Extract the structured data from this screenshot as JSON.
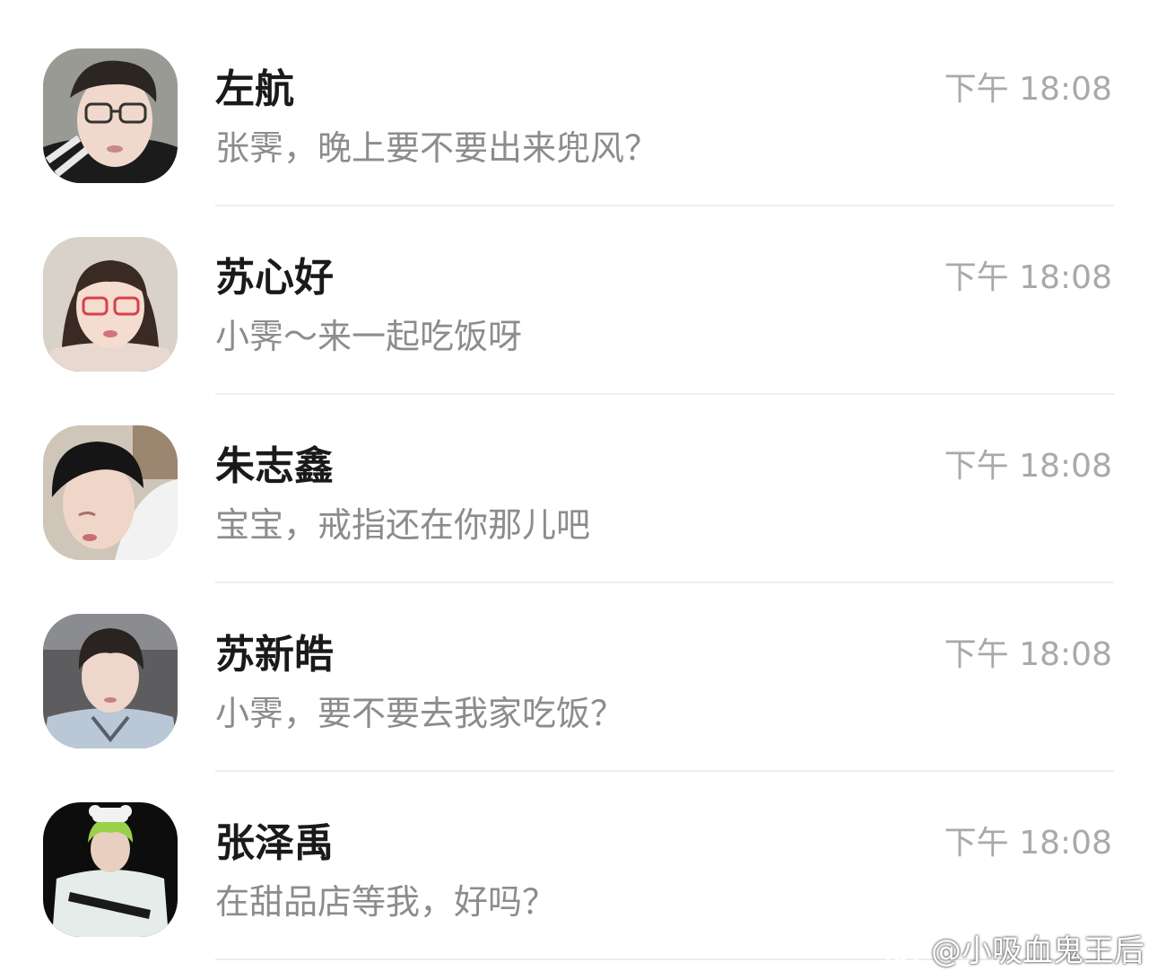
{
  "chats": [
    {
      "name": "左航",
      "message": "张霁，晚上要不要出来兜风？",
      "time": "下午 18:08",
      "avatar": {
        "icon": "avatar-photo",
        "bg": "#9a9a95",
        "skin": "#f0d8cc",
        "hair": "#2c2623",
        "shirt": "#1b1b1b"
      }
    },
    {
      "name": "苏心好",
      "message": "小霁～来一起吃饭呀",
      "time": "下午 18:08",
      "avatar": {
        "icon": "avatar-photo",
        "bg": "#d8d2c8",
        "skin": "#f4dccf",
        "hair": "#3a2a24",
        "shirt": "#e8d8d0"
      }
    },
    {
      "name": "朱志鑫",
      "message": "宝宝，戒指还在你那儿吧",
      "time": "下午 18:08",
      "avatar": {
        "icon": "avatar-photo",
        "bg": "#cfc5b8",
        "skin": "#efd6c8",
        "hair": "#151515",
        "shirt": "#f2f2f2"
      }
    },
    {
      "name": "苏新皓",
      "message": "小霁，要不要去我家吃饭？",
      "time": "下午 18:08",
      "avatar": {
        "icon": "avatar-photo",
        "bg": "#5d5d60",
        "skin": "#eed6ca",
        "hair": "#2a2420",
        "shirt": "#b9c7d6"
      }
    },
    {
      "name": "张泽禹",
      "message": "在甜品店等我，好吗？",
      "time": "下午 18:08",
      "avatar": {
        "icon": "avatar-photo",
        "bg": "#0d0d0d",
        "skin": "#e8cfc0",
        "hair": "#9ad14a",
        "shirt": "#e6ece9"
      }
    }
  ],
  "watermark": {
    "text": "@小吸血鬼王后",
    "icon": "weibo-logo-icon"
  }
}
